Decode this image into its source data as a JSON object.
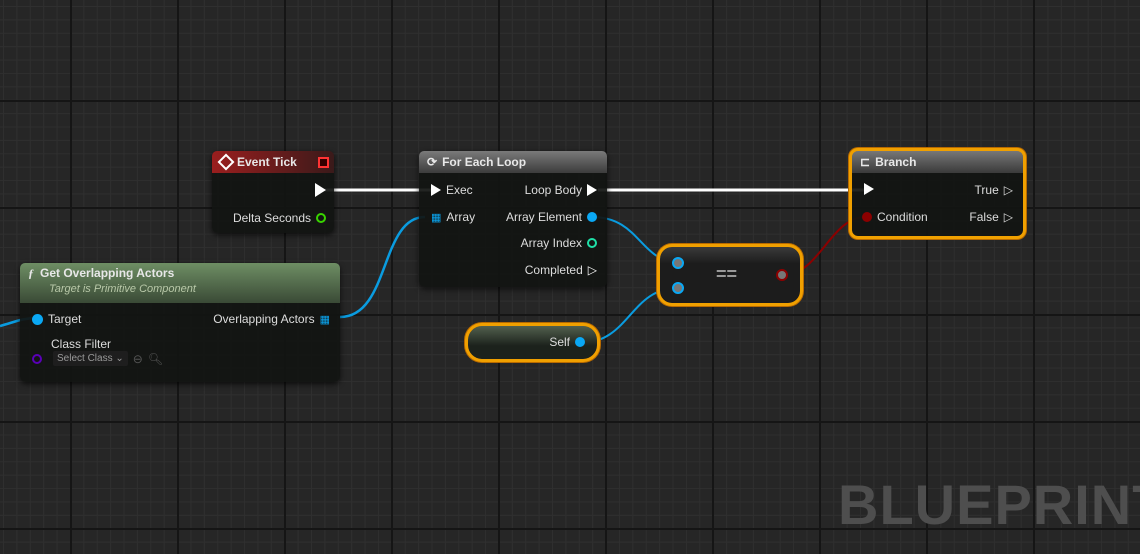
{
  "colors": {
    "exec": "#ffffff",
    "object": "#00a8f4",
    "float": "#39d400",
    "int": "#1fe0a8",
    "bool": "#8c0000",
    "class": "#5a00b8",
    "event_header": "#8a1c1c",
    "function_header": "#5a7a50",
    "selection": "#f0a000"
  },
  "nodes": {
    "event_tick": {
      "title": "Event Tick",
      "icon": "event-diamond-icon",
      "pins": {
        "delta": "Delta Seconds"
      }
    },
    "for_each": {
      "title": "For Each Loop",
      "icon": "loop-icon",
      "pins": {
        "exec": "Exec",
        "array": "Array",
        "loop_body": "Loop Body",
        "array_element": "Array Element",
        "array_index": "Array Index",
        "completed": "Completed"
      }
    },
    "get_overlapping": {
      "title": "Get Overlapping Actors",
      "subtitle": "Target is Primitive Component",
      "icon": "function-icon",
      "pins": {
        "target": "Target",
        "class_filter": "Class Filter",
        "select_class": "Select Class",
        "overlapping": "Overlapping Actors"
      }
    },
    "branch": {
      "title": "Branch",
      "icon": "branch-icon",
      "pins": {
        "condition": "Condition",
        "true": "True",
        "false": "False"
      }
    },
    "equals": {
      "title": "=="
    },
    "self": {
      "title": "Self"
    }
  },
  "watermark": "BLUEPRINT"
}
